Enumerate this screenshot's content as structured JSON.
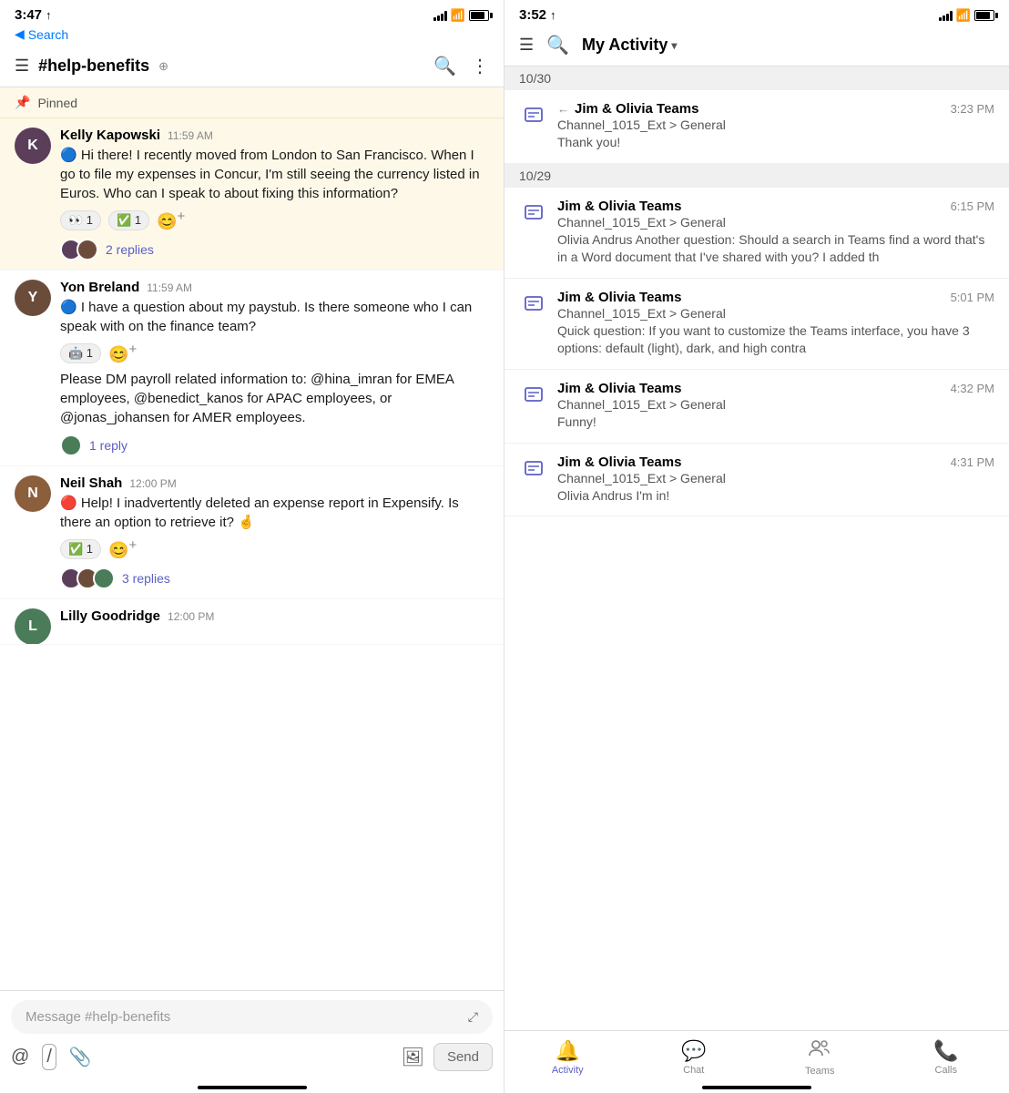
{
  "left": {
    "statusBar": {
      "time": "3:47",
      "location": "↑",
      "backLabel": "Search"
    },
    "channel": {
      "name": "#help-benefits",
      "coIcon": "co"
    },
    "pinnedLabel": "Pinned",
    "messages": [
      {
        "id": "msg1",
        "author": "Kelly Kapowski",
        "time": "11:59 AM",
        "avatarClass": "kelly",
        "avatarInitial": "K",
        "emoji": "🔵",
        "text": "Hi there! I recently moved from London to San Francisco. When I go to file my expenses in Concur, I'm still seeing the currency listed in Euros. Who can I speak to about fixing this information?",
        "reactions": [
          {
            "emoji": "👀",
            "count": "1"
          },
          {
            "emoji": "✅",
            "count": "1"
          }
        ],
        "repliesCount": "2 replies",
        "hasReplies": true,
        "pinned": true
      },
      {
        "id": "msg2",
        "author": "Yon Breland",
        "time": "11:59 AM",
        "avatarClass": "yon",
        "avatarInitial": "Y",
        "emoji": "🔵",
        "text": "I have a question about my paystub. Is there someone who I can speak with on the finance team?",
        "reactions": [
          {
            "emoji": "🤖",
            "count": "1"
          }
        ],
        "hasReplies": false,
        "pinned": false,
        "payrollText": "Please DM payroll related information to: @hina_imran for EMEA employees, @benedict_kanos for APAC employees, or @jonas_johansen for AMER employees.",
        "repliesCount": "1 reply",
        "hasPayrollReply": true
      },
      {
        "id": "msg3",
        "author": "Neil Shah",
        "time": "12:00 PM",
        "avatarClass": "neil",
        "avatarInitial": "N",
        "emoji": "🔴",
        "text": "Help! I inadvertently deleted an expense report in Expensify. Is there an option to retrieve it? 🤞",
        "reactions": [
          {
            "emoji": "✅",
            "count": "1"
          }
        ],
        "repliesCount": "3 replies",
        "hasReplies": true,
        "pinned": false
      },
      {
        "id": "msg4",
        "author": "Lilly Goodridge",
        "time": "12:00 PM",
        "avatarClass": "lilly",
        "avatarInitial": "L",
        "text": "",
        "pinned": false,
        "partialVisible": true
      }
    ],
    "inputPlaceholder": "Message #help-benefits",
    "sendLabel": "Send"
  },
  "right": {
    "statusBar": {
      "time": "3:52",
      "location": "↑"
    },
    "header": {
      "title": "My Activity",
      "chevron": "▾"
    },
    "sections": [
      {
        "date": "10/30",
        "items": [
          {
            "teamName": "Jim & Olivia Teams",
            "channel": "Channel_1015_Ext > General",
            "time": "3:23 PM",
            "preview": "Thank you!",
            "hasArrow": true
          }
        ]
      },
      {
        "date": "10/29",
        "items": [
          {
            "teamName": "Jim & Olivia Teams",
            "channel": "Channel_1015_Ext > General",
            "time": "6:15 PM",
            "preview": "Olivia Andrus Another question: Should a search in Teams find a word that's in a Word document that I've shared with you? I added th",
            "hasArrow": false
          },
          {
            "teamName": "Jim & Olivia Teams",
            "channel": "Channel_1015_Ext > General",
            "time": "5:01 PM",
            "preview": "Quick question: If you want to customize the Teams interface, you have 3 options: default (light), dark, and high contra",
            "hasArrow": false
          },
          {
            "teamName": "Jim & Olivia Teams",
            "channel": "Channel_1015_Ext > General",
            "time": "4:32 PM",
            "preview": "Funny!",
            "hasArrow": false
          },
          {
            "teamName": "Jim & Olivia Teams",
            "channel": "Channel_1015_Ext > General",
            "time": "4:31 PM",
            "preview": "Olivia Andrus I'm in!",
            "hasArrow": false
          }
        ]
      }
    ],
    "tabs": [
      {
        "label": "Activity",
        "icon": "🔔",
        "active": true
      },
      {
        "label": "Chat",
        "icon": "💬",
        "active": false
      },
      {
        "label": "Teams",
        "icon": "👥",
        "active": false
      },
      {
        "label": "Calls",
        "icon": "📞",
        "active": false
      }
    ]
  }
}
